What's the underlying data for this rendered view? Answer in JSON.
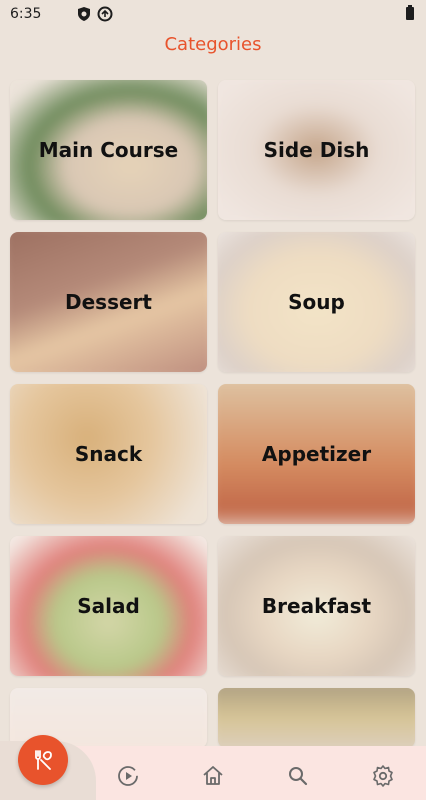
{
  "status": {
    "time": "6:35"
  },
  "header": {
    "title": "Categories"
  },
  "categories": [
    {
      "label": "Main Course"
    },
    {
      "label": "Side Dish"
    },
    {
      "label": "Dessert"
    },
    {
      "label": "Soup"
    },
    {
      "label": "Snack"
    },
    {
      "label": "Appetizer"
    },
    {
      "label": "Salad"
    },
    {
      "label": "Breakfast"
    }
  ],
  "bottom_nav": {
    "items": [
      {
        "icon": "utensils-icon"
      },
      {
        "icon": "play-icon"
      },
      {
        "icon": "home-icon"
      },
      {
        "icon": "search-icon"
      },
      {
        "icon": "gear-icon"
      }
    ]
  },
  "colors": {
    "accent": "#e8532c",
    "background": "#ece3da",
    "nav_background": "#fbe5e1"
  }
}
